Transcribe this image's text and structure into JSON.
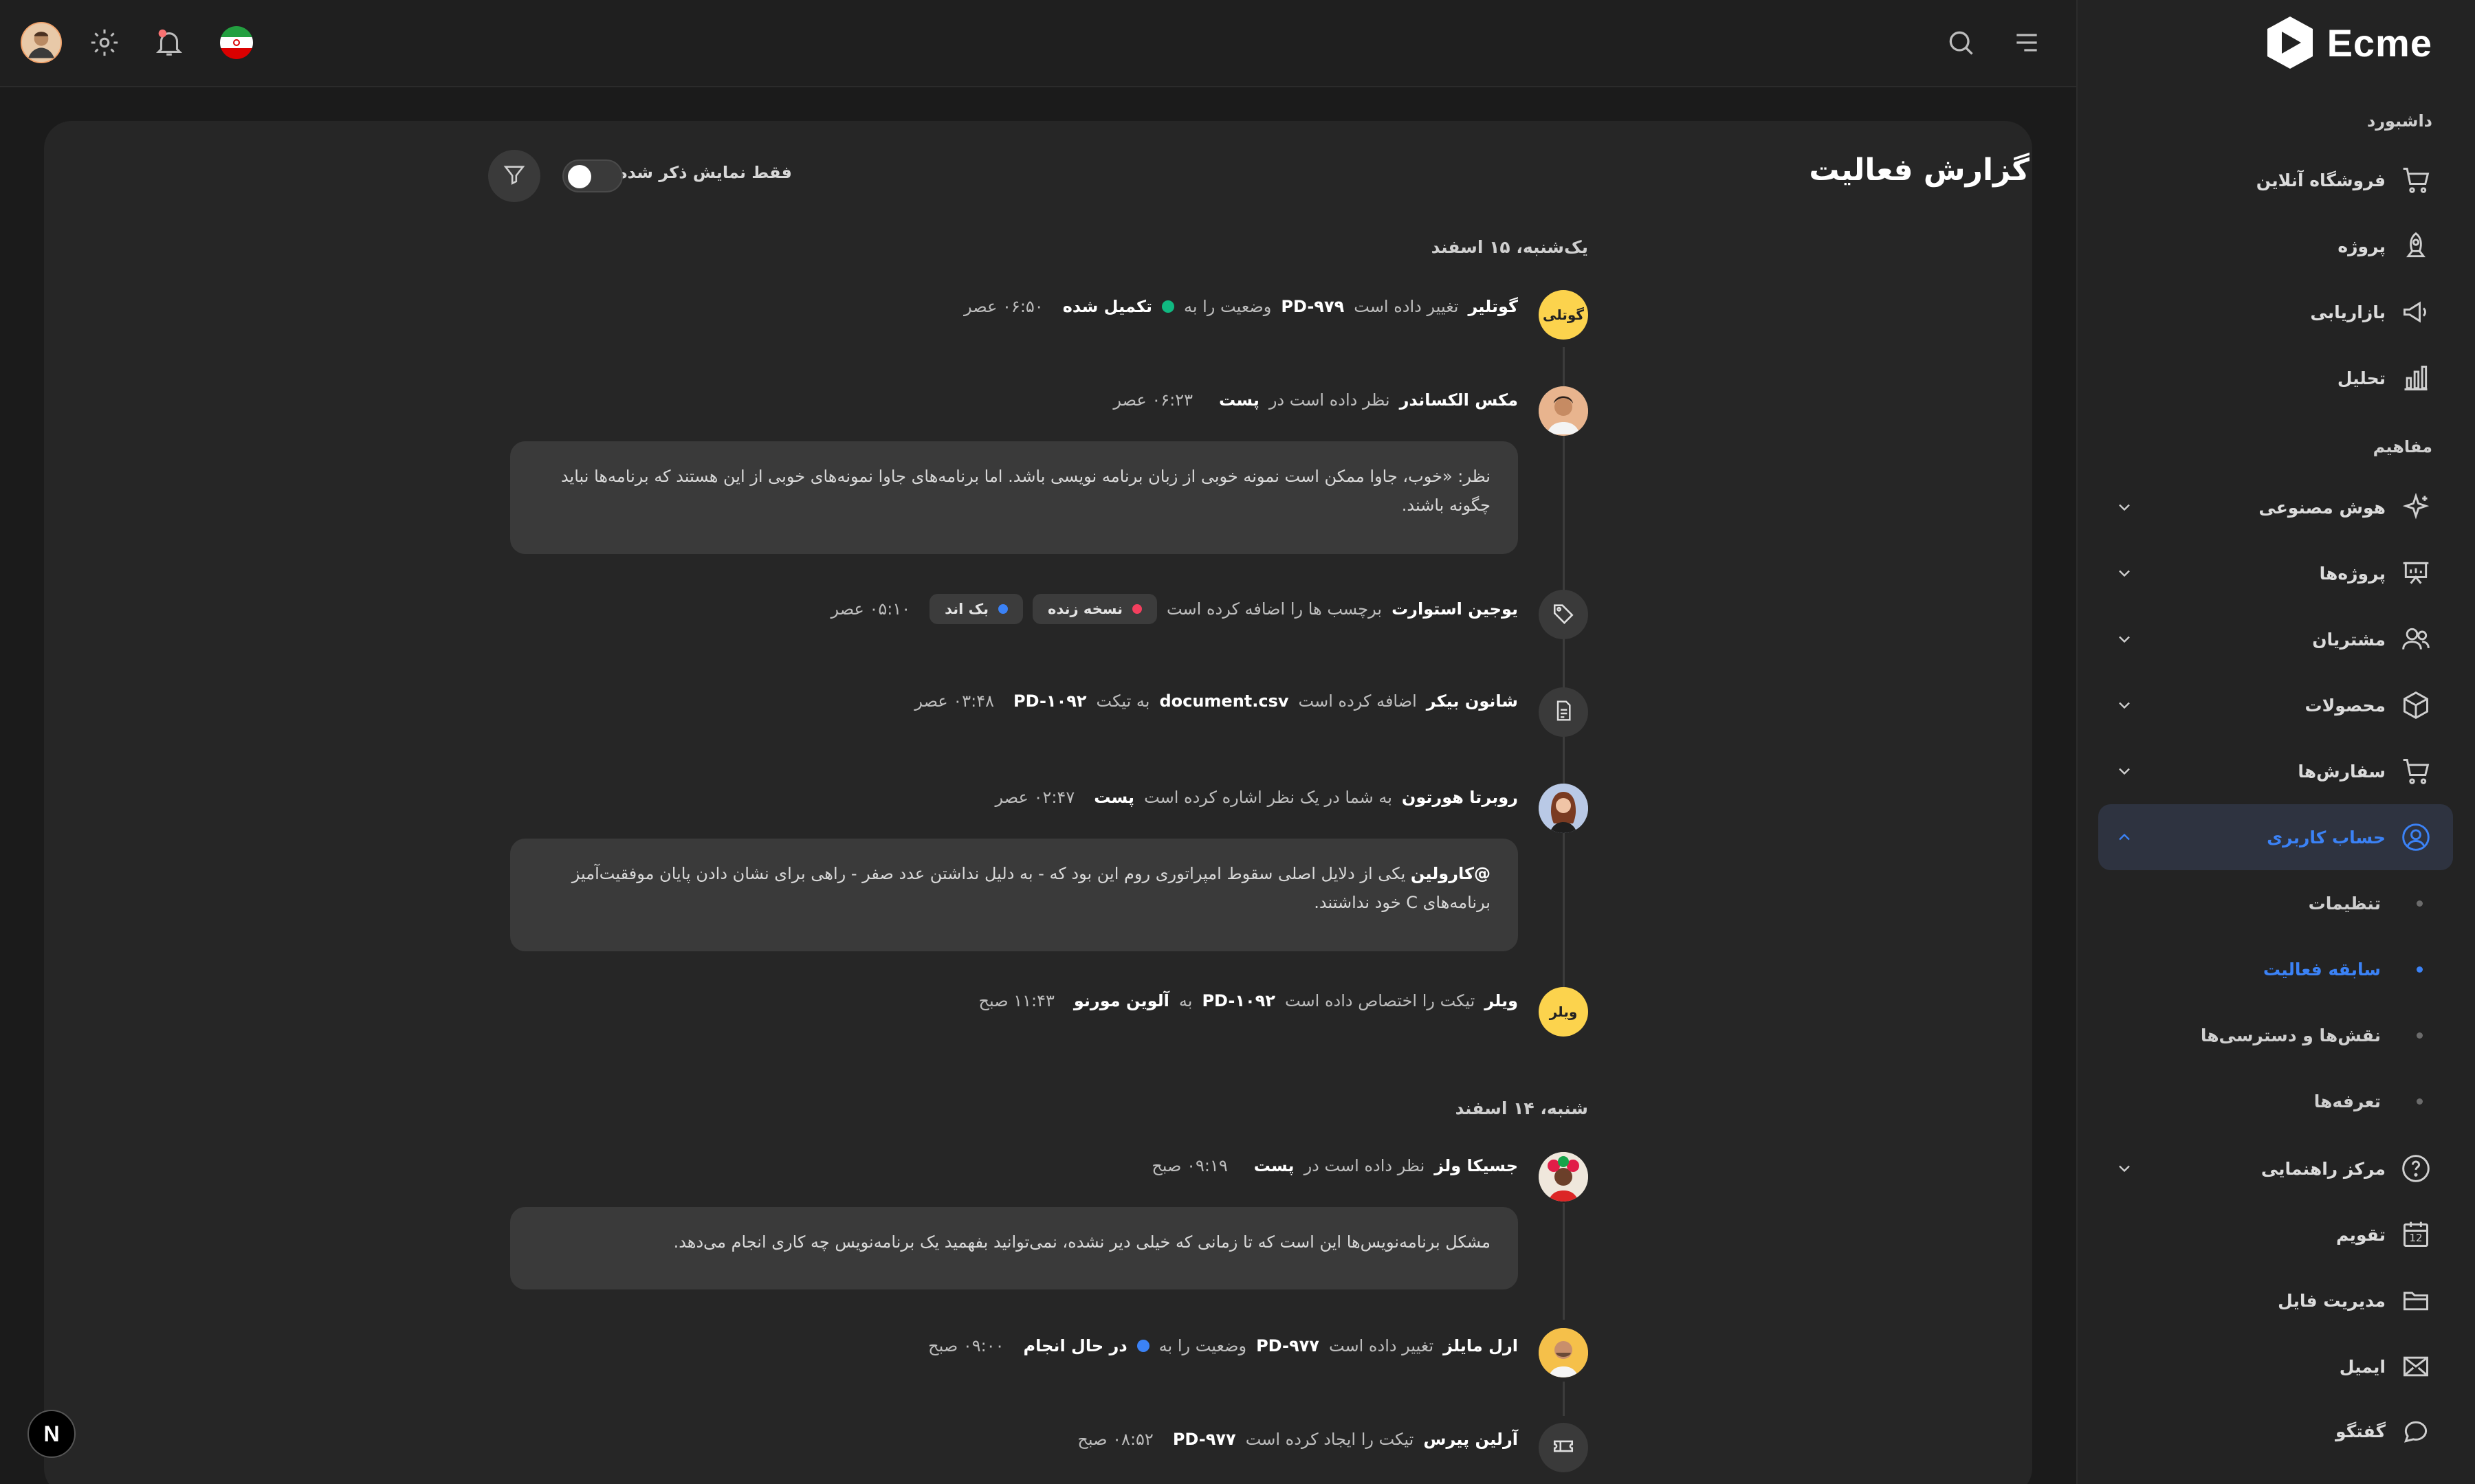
{
  "brand": {
    "name": "Ecme"
  },
  "sidebar": {
    "sections": [
      {
        "label": "داشبورد"
      },
      {
        "label": "مفاهیم"
      }
    ],
    "dashboard_items": [
      {
        "label": "فروشگاه آنلاین",
        "icon": "cart-icon"
      },
      {
        "label": "پروژه",
        "icon": "rocket-icon"
      },
      {
        "label": "بازاریابی",
        "icon": "megaphone-icon"
      },
      {
        "label": "تحلیل",
        "icon": "bar-chart-icon"
      }
    ],
    "concept_items": [
      {
        "label": "هوش مصنوعی",
        "icon": "sparkle-icon"
      },
      {
        "label": "پروژه‌ها",
        "icon": "presentation-icon"
      },
      {
        "label": "مشتریان",
        "icon": "users-icon"
      },
      {
        "label": "محصولات",
        "icon": "box-icon"
      },
      {
        "label": "سفارش‌ها",
        "icon": "cart-icon"
      },
      {
        "label": "حساب کاربری",
        "icon": "user-circle-icon"
      }
    ],
    "account_sub": [
      {
        "label": "تنظیمات"
      },
      {
        "label": "سابقه فعالیت"
      },
      {
        "label": "نقش‌ها و دسترسی‌ها"
      },
      {
        "label": "تعرفه‌ها"
      }
    ],
    "bottom_items": [
      {
        "label": "مرکز راهنمایی",
        "icon": "help-icon"
      },
      {
        "label": "تقویم",
        "icon": "calendar-icon"
      },
      {
        "label": "مدیریت فایل",
        "icon": "folder-icon"
      },
      {
        "label": "ایمیل",
        "icon": "mail-icon"
      },
      {
        "label": "گفتگو",
        "icon": "chat-icon"
      }
    ],
    "calendar_day": "12"
  },
  "page": {
    "title": "گزارش فعالیت",
    "toggle_label": "فقط نمایش ذکر شده‌ها"
  },
  "groups": [
    {
      "date": "یک‌شنبه، ۱۵ اسفند"
    },
    {
      "date": "شنبه، ۱۴ اسفند"
    }
  ],
  "activities": [
    {
      "avatar_text": "گوتلی",
      "user": "گوتلیر",
      "text1": "تغییر داده است",
      "ticket": "PD-۹۷۹",
      "text2": "وضعیت را به",
      "status": "تکمیل شده",
      "status_color": "#10b981",
      "time": "۰۶:۵۰ عصر"
    },
    {
      "user": "مکس الکساندر",
      "text1": "نظر داده است در",
      "target": "پست",
      "time": "۰۶:۲۳ عصر",
      "comment": "نظر: «خوب، جاوا ممکن است نمونه خوبی از زبان برنامه نویسی باشد. اما برنامه‌های جاوا نمونه‌های خوبی از این هستند که برنامه‌ها نباید چگونه باشند."
    },
    {
      "user": "یوجین استوارت",
      "text1": "برچسب ها را اضافه کرده است",
      "tags": [
        {
          "label": "نسخه زنده",
          "color": "#f43f5e"
        },
        {
          "label": "بک اند",
          "color": "#3b82f6"
        }
      ],
      "time": "۰۵:۱۰ عصر"
    },
    {
      "user": "شانون بیکر",
      "text1": "اضافه کرده است",
      "file": "document.csv",
      "text2": "به تیکت",
      "ticket": "PD-۱۰۹۲",
      "time": "۰۳:۴۸ عصر"
    },
    {
      "user": "روبرتا هورتون",
      "text1": "به شما در یک نظر اشاره کرده است",
      "target": "پست",
      "time": "۰۲:۴۷ عصر",
      "mention": "@کارولین",
      "comment": "یکی از دلایل اصلی سقوط امپراتوری روم این بود که - به دلیل نداشتن عدد صفر - راهی برای نشان دادن پایان موفقیت‌آمیز برنامه‌های C خود نداشتند."
    },
    {
      "avatar_text": "ویلر",
      "user": "ویلر",
      "text1": "تیکت را اختصاص داده است",
      "ticket": "PD-۱۰۹۲",
      "text2": "به",
      "assignee": "آلوین مورنو",
      "time": "۱۱:۴۳ صبح"
    },
    {
      "user": "جسیکا ولز",
      "text1": "نظر داده است در",
      "target": "پست",
      "time": "۰۹:۱۹ صبح",
      "comment": "مشکل برنامه‌نویس‌ها این است که تا زمانی که خیلی دیر نشده، نمی‌توانید بفهمید یک برنامه‌نویس چه کاری انجام می‌دهد."
    },
    {
      "user": "ارل مایلز",
      "text1": "تغییر داده است",
      "ticket": "PD-۹۷۷",
      "text2": "وضعیت را به",
      "status": "در حال انجام",
      "status_color": "#3b82f6",
      "time": "۰۹:۰۰ صبح"
    },
    {
      "user": "آرلین پیرس",
      "text1": "تیکت را ایجاد کرده است",
      "ticket": "PD-۹۷۷",
      "time": "۰۸:۵۲ صبح"
    }
  ],
  "footer_badge": "N",
  "colors": {
    "accent": "#3b82f6",
    "success": "#10b981",
    "danger": "#f43f5e",
    "background": "#1b1b1b",
    "card": "#262626"
  }
}
